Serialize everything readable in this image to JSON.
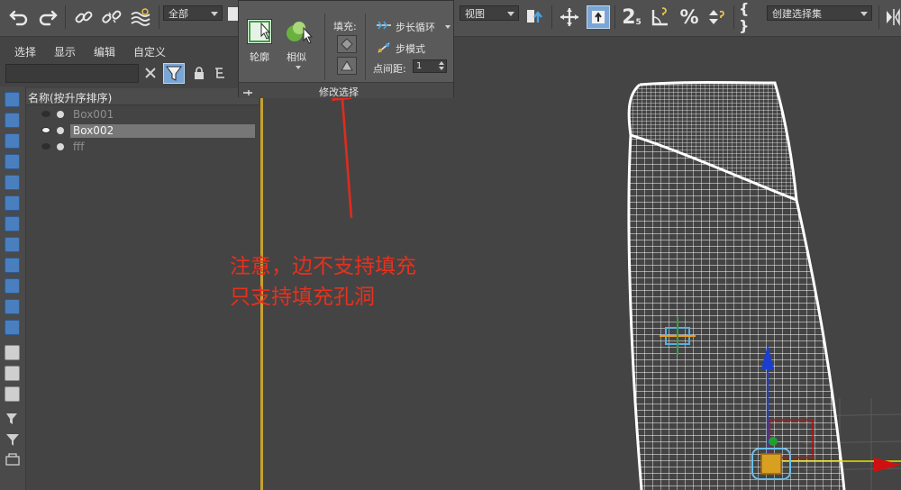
{
  "toolbar": {
    "selection_filter": "全部",
    "reference_coord": "视图",
    "named_selection": "创建选择集",
    "angle_snap_label": "2",
    "angle_snap_sub": "5",
    "percent_label": "%",
    "brace_label": "{ }"
  },
  "ribbon": {
    "outline_label": "轮廓",
    "similar_label": "相似",
    "fill_label": "填充:",
    "step_loop_label": "步长循环",
    "step_mode_label": "步模式",
    "dot_gap_label": "点间距:",
    "dot_gap_value": "1",
    "footer_title": "修改选择"
  },
  "explorer_menu": {
    "items": [
      "选择",
      "显示",
      "编辑",
      "自定义"
    ]
  },
  "explorer": {
    "column_header": "名称(按升序排序)",
    "rows": [
      {
        "name": "Box001",
        "selected": false
      },
      {
        "name": "Box002",
        "selected": true
      },
      {
        "name": "fff",
        "selected": false
      }
    ]
  },
  "annotation": {
    "line1": "注意，边不支持填充",
    "line2": "只支持填充孔洞",
    "color": "#e8301d"
  },
  "colors": {
    "accent_blue": "#4a7fbf",
    "viewport_border": "#c9a12b",
    "wireframe": "#ffffff"
  }
}
